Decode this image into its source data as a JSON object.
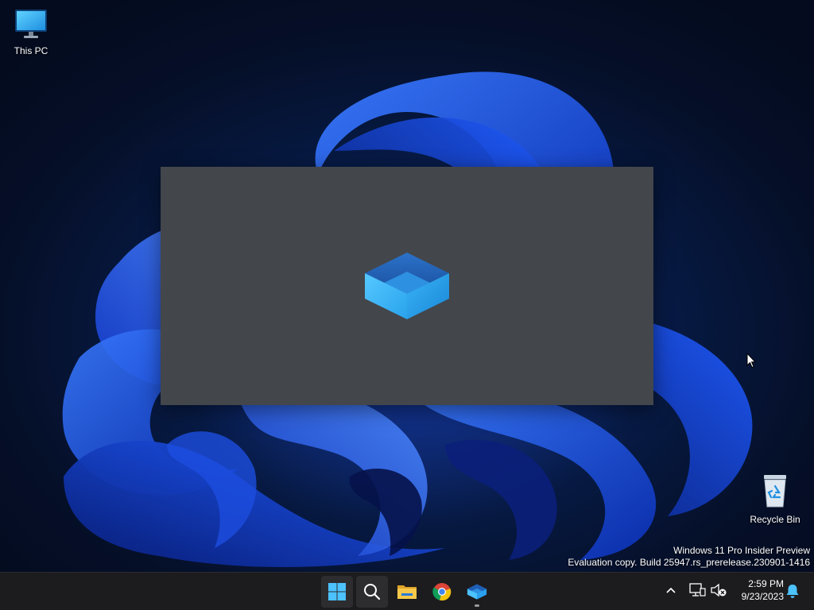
{
  "desktop": {
    "icons": [
      {
        "label": "This PC"
      },
      {
        "label": "Recycle Bin"
      }
    ],
    "watermark": {
      "line1": "Windows 11 Pro Insider Preview",
      "line2": "Evaluation copy. Build 25947.rs_prerelease.230901-1416"
    }
  },
  "splash": {
    "icon": "app-box-icon"
  },
  "taskbar": {
    "apps": [
      {
        "name": "start",
        "icon": "windows-logo-icon"
      },
      {
        "name": "search",
        "icon": "search-icon"
      },
      {
        "name": "file-explorer",
        "icon": "folder-icon"
      },
      {
        "name": "chrome",
        "icon": "chrome-icon"
      },
      {
        "name": "app",
        "icon": "app-box-icon",
        "running": true
      }
    ],
    "tray": {
      "time": "2:59 PM",
      "date": "9/23/2023"
    }
  },
  "colors": {
    "accent": "#2f7ad8",
    "taskbar": "#1c1c1e",
    "splash": "#43464b"
  }
}
